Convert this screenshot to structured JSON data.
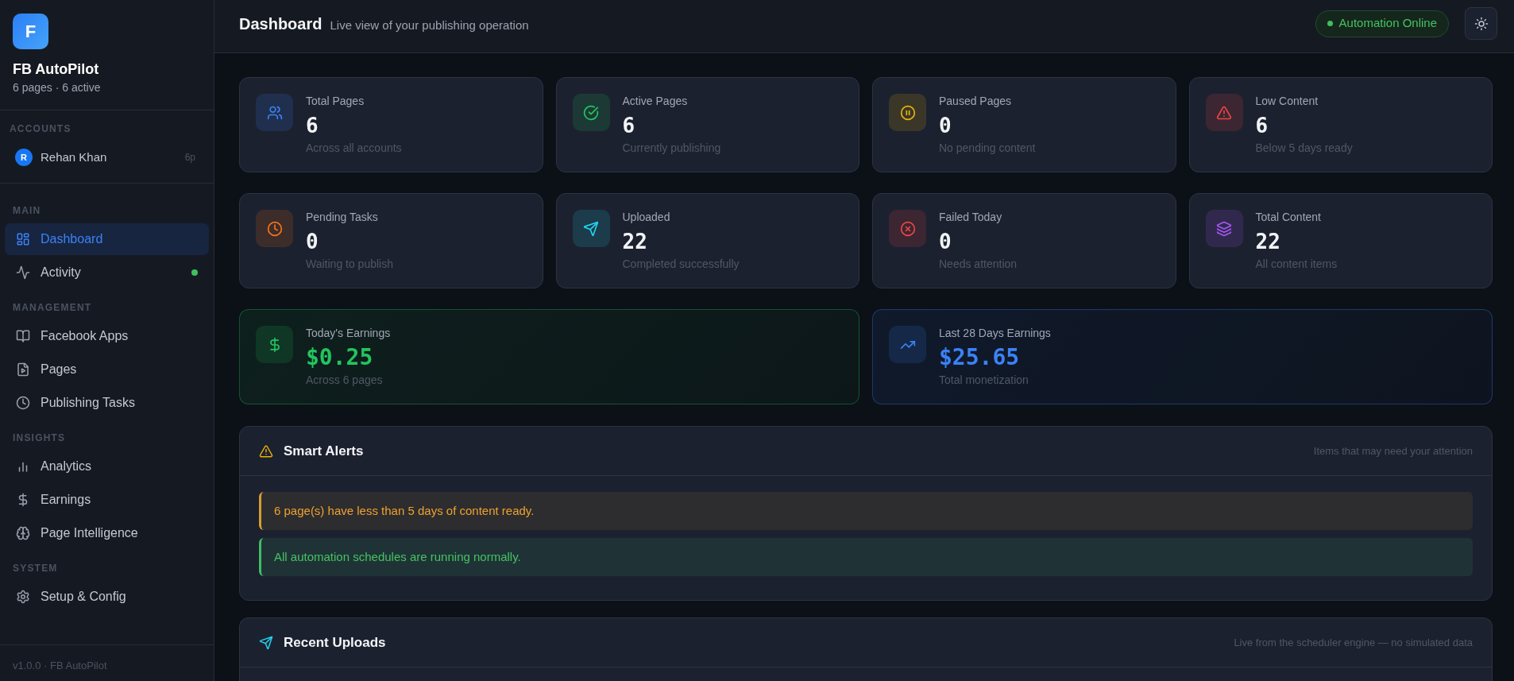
{
  "sidebar": {
    "logo": "F",
    "app_name": "FB AutoPilot",
    "summary": "6 pages · 6 active",
    "accounts_heading": "ACCOUNTS",
    "accounts": [
      {
        "initial": "R",
        "name": "Rehan Khan",
        "pages": "6p"
      }
    ],
    "sections": [
      {
        "heading": "MAIN",
        "items": [
          {
            "label": "Dashboard",
            "selected": true,
            "live": false
          },
          {
            "label": "Activity",
            "selected": false,
            "live": true
          }
        ]
      },
      {
        "heading": "MANAGEMENT",
        "items": [
          {
            "label": "Facebook Apps",
            "selected": false,
            "live": false
          },
          {
            "label": "Pages",
            "selected": false,
            "live": false
          },
          {
            "label": "Publishing Tasks",
            "selected": false,
            "live": false
          }
        ]
      },
      {
        "heading": "INSIGHTS",
        "items": [
          {
            "label": "Analytics",
            "selected": false,
            "live": false
          },
          {
            "label": "Earnings",
            "selected": false,
            "live": false
          },
          {
            "label": "Page Intelligence",
            "selected": false,
            "live": false
          }
        ]
      },
      {
        "heading": "SYSTEM",
        "items": [
          {
            "label": "Setup & Config",
            "selected": false,
            "live": false
          }
        ]
      }
    ],
    "footer": "v1.0.0 · FB AutoPilot"
  },
  "header": {
    "title": "Dashboard",
    "subtitle": "Live view of your publishing operation",
    "status": {
      "label": "Automation Online",
      "online": true
    }
  },
  "stats": [
    {
      "label": "Total Pages",
      "value": "6",
      "caption": "Across all accounts",
      "color": "#3b82f6"
    },
    {
      "label": "Active Pages",
      "value": "6",
      "caption": "Currently publishing",
      "color": "#22c55e"
    },
    {
      "label": "Paused Pages",
      "value": "0",
      "caption": "No pending content",
      "color": "#eab308"
    },
    {
      "label": "Low Content",
      "value": "6",
      "caption": "Below 5 days ready",
      "color": "#ef4444"
    },
    {
      "label": "Pending Tasks",
      "value": "0",
      "caption": "Waiting to publish",
      "color": "#f97316"
    },
    {
      "label": "Uploaded",
      "value": "22",
      "caption": "Completed successfully",
      "color": "#22d3ee"
    },
    {
      "label": "Failed Today",
      "value": "0",
      "caption": "Needs attention",
      "color": "#ef4444"
    },
    {
      "label": "Total Content",
      "value": "22",
      "caption": "All content items",
      "color": "#a855f7"
    }
  ],
  "earnings": [
    {
      "label": "Today's Earnings",
      "value": "$0.25",
      "caption": "Across 6 pages",
      "color": "#22c55e"
    },
    {
      "label": "Last 28 Days Earnings",
      "value": "$25.65",
      "caption": "Total monetization",
      "color": "#3b82f6"
    }
  ],
  "alerts_panel": {
    "title": "Smart Alerts",
    "note": "Items that may need your attention",
    "alerts": [
      {
        "kind": "warning",
        "text": "6 page(s) have less than 5 days of content ready."
      },
      {
        "kind": "success",
        "text": "All automation schedules are running normally."
      }
    ]
  },
  "uploads_panel": {
    "title": "Recent Uploads",
    "note": "Live from the scheduler engine — no simulated data"
  }
}
